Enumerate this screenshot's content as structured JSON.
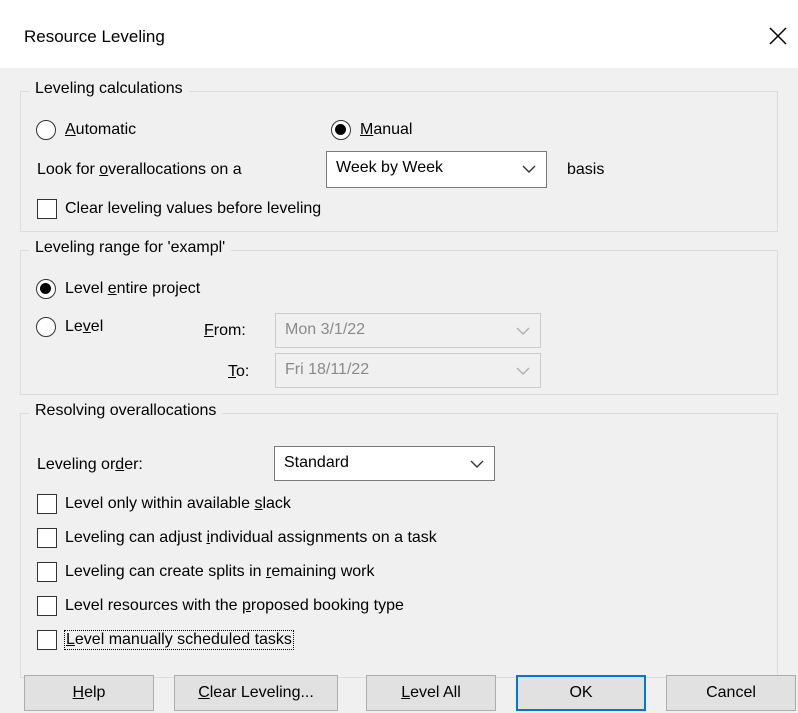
{
  "window": {
    "title": "Resource Leveling"
  },
  "icons": {
    "close": "close-icon",
    "dropdown": "chevron-down-icon"
  },
  "calc": {
    "title": "Leveling calculations",
    "automatic_label": "Automatic",
    "manual_label": "Manual",
    "mode_selected": "Manual",
    "look_for_label": "Look for overallocations on a",
    "basis_value": "Week by Week",
    "basis_suffix": "basis",
    "clear_values_label": "Clear leveling values before leveling",
    "clear_values_checked": false
  },
  "range": {
    "title": "Leveling range for 'exampl'",
    "entire_label": "Level entire project",
    "level_label": "Level",
    "selected": "entire",
    "from_label": "From:",
    "from_value": "Mon 3/1/22",
    "to_label": "To:",
    "to_value": "Fri 18/11/22"
  },
  "resolve": {
    "title": "Resolving overallocations",
    "order_label": "Leveling order:",
    "order_value": "Standard",
    "options": [
      {
        "label": "Level only within available slack",
        "checked": false
      },
      {
        "label": "Leveling can adjust individual assignments on a task",
        "checked": false
      },
      {
        "label": "Leveling can create splits in remaining work",
        "checked": false
      },
      {
        "label": "Level resources with the proposed booking type",
        "checked": false
      },
      {
        "label": "Level manually scheduled tasks",
        "checked": false
      }
    ]
  },
  "buttons": {
    "help": "Help",
    "clear_leveling": "Clear Leveling...",
    "level_all": "Level All",
    "ok": "OK",
    "cancel": "Cancel"
  }
}
